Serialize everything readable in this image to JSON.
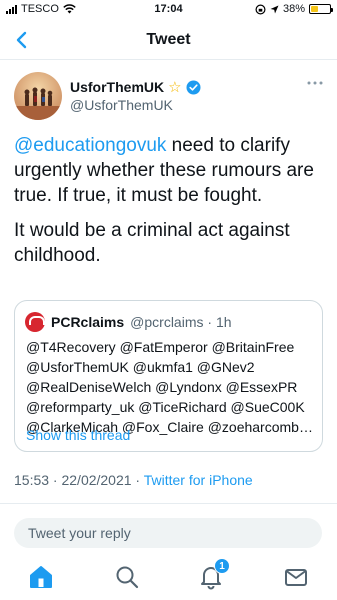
{
  "status_bar": {
    "carrier": "TESCO",
    "time": "17:04",
    "battery": "38%",
    "battery_level": 0.38,
    "icons": [
      "signal-icon",
      "wifi-icon",
      "location-arrow-icon",
      "battery-icon"
    ]
  },
  "header": {
    "title": "Tweet",
    "back_icon": "chevron-left-icon"
  },
  "tweet": {
    "author_name": "UsforThemUK",
    "author_handle": "@UsforThemUK",
    "name_emoji": "☆",
    "text_mention": "@educationgovuk",
    "text_line1_rest": " need to clarify urgently whether these rumours are true. If true, it must be fought.",
    "text_line2": "It would be a criminal act against childhood.",
    "timestamp": "15:53 · 22/02/2021 · ",
    "source": "Twitter for iPhone"
  },
  "quoted_tweet": {
    "author_name": "PCRclaims",
    "author_handle": "@pcrclaims",
    "time_ago": " · 1h",
    "lines": [
      "@T4Recovery @FatEmperor @BritainFree",
      "@UsforThemUK @ukmfa1 @GNev2",
      "@RealDeniseWelch @Lyndonx @EssexPR",
      "@reformparty_uk @TiceRichard @SueC00K",
      "@ClarkeMicah @Fox_Claire @zoeharcombe..."
    ],
    "show_thread": "Show this thread"
  },
  "reply": {
    "placeholder": "Tweet your reply"
  },
  "tab_bar": {
    "notification_count": "1",
    "icons": [
      "home-icon",
      "search-icon",
      "notifications-icon",
      "messages-icon"
    ]
  },
  "colors": {
    "accent": "#1d9bf0",
    "text": "#0f1419",
    "muted": "#536471",
    "border": "#cfd9de"
  }
}
